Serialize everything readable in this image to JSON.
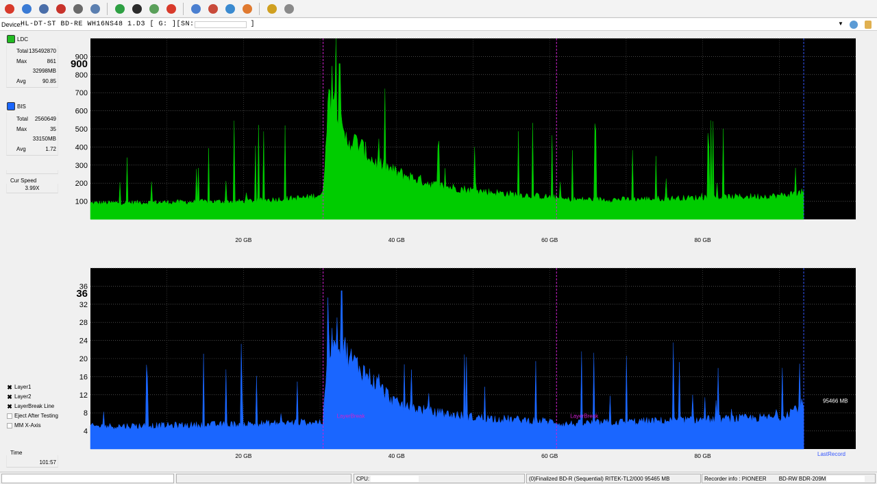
{
  "toolbar": {
    "buttons": [
      {
        "name": "power-button",
        "icon": "power-icon",
        "color": "#d83a2b"
      },
      {
        "name": "info-button",
        "icon": "info-icon",
        "color": "#3a7bd5"
      },
      {
        "name": "drive-info-button",
        "icon": "drive-icon",
        "color": "#4a6ea9"
      },
      {
        "name": "erase-button",
        "icon": "eraser-icon",
        "color": "#c8332b"
      },
      {
        "name": "eject-button",
        "icon": "eject-icon",
        "color": "#6a6a6a"
      },
      {
        "name": "media-button",
        "icon": "media-icon",
        "color": "#5b7fb0"
      },
      {
        "name": "refresh-button",
        "icon": "refresh-icon",
        "color": "#2ea043"
      },
      {
        "name": "scan-button",
        "icon": "scan-icon",
        "color": "#2b2b2b"
      },
      {
        "name": "settings-button",
        "icon": "settings-icon",
        "color": "#5aa05a"
      },
      {
        "name": "stop-button",
        "icon": "stop-icon",
        "color": "#d83a2b"
      },
      {
        "name": "disc-button",
        "icon": "disc-icon",
        "color": "#4a7fd0"
      },
      {
        "name": "burn-button",
        "icon": "burn-icon",
        "color": "#c84a3a"
      },
      {
        "name": "copy-button",
        "icon": "copy-icon",
        "color": "#3a8ad0"
      },
      {
        "name": "test-button",
        "icon": "test-icon",
        "color": "#e07a30"
      },
      {
        "name": "chart-button",
        "icon": "chart-icon",
        "color": "#d0a020"
      },
      {
        "name": "print-button",
        "icon": "printer-icon",
        "color": "#8a8a8a"
      }
    ]
  },
  "device": {
    "label": "Device:",
    "name": "HL-DT-ST BD-RE  WH16NS48  1.D3 [ G: ][SN:",
    "close": "]"
  },
  "sidebar": {
    "ldc": {
      "label": "LDC",
      "color": "#22bb22",
      "total_label": "Total",
      "total": "135492870",
      "max_label": "Max",
      "max": "861",
      "max_mb": "32998MB",
      "avg_label": "Avg",
      "avg": "90.85"
    },
    "bis": {
      "label": "BIS",
      "color": "#1a66ff",
      "total_label": "Total",
      "total": "2560649",
      "max_label": "Max",
      "max": "35",
      "max_mb": "33150MB",
      "avg_label": "Avg",
      "avg": "1.72"
    },
    "cur_speed_label": "Cur Speed",
    "cur_speed": "3.99X",
    "checkboxes": [
      {
        "label": "Layer1",
        "checked": true
      },
      {
        "label": "Layer2",
        "checked": true
      },
      {
        "label": "LayerBreak Line",
        "checked": true
      },
      {
        "label": "Eject After Testing",
        "checked": false
      },
      {
        "label": "MM X-Axis",
        "checked": false
      }
    ],
    "time_label": "Time",
    "time": "101:57"
  },
  "chart_data": [
    {
      "type": "area",
      "name": "LDC",
      "color": "#00cc00",
      "ylim": [
        0,
        1000
      ],
      "yticks": [
        100,
        200,
        300,
        400,
        500,
        600,
        700,
        800,
        900
      ],
      "ymax_label": "900",
      "xlim": [
        0,
        100
      ],
      "xticks": [
        20,
        40,
        60,
        80
      ],
      "xtick_labels": [
        "20 GB",
        "40 GB",
        "60 GB",
        "80 GB"
      ],
      "data_end_gb": 93.2,
      "layer_breaks_gb": [
        30.4,
        60.9
      ],
      "end_line_gb": 93.2,
      "baseline_profile": [
        [
          0,
          90
        ],
        [
          10,
          95
        ],
        [
          20,
          100
        ],
        [
          28,
          120
        ],
        [
          30.4,
          140
        ],
        [
          31,
          650
        ],
        [
          32,
          700
        ],
        [
          33,
          450
        ],
        [
          35,
          420
        ],
        [
          37,
          320
        ],
        [
          40,
          260
        ],
        [
          45,
          190
        ],
        [
          50,
          160
        ],
        [
          55,
          140
        ],
        [
          60.9,
          120
        ],
        [
          61.5,
          110
        ],
        [
          70,
          110
        ],
        [
          80,
          120
        ],
        [
          90,
          130
        ],
        [
          93.2,
          150
        ]
      ],
      "peak_value": 861,
      "peak_gb": 32.5
    },
    {
      "type": "area",
      "name": "BIS",
      "color": "#1a66ff",
      "ylim": [
        0,
        40
      ],
      "yticks": [
        4,
        8,
        12,
        16,
        20,
        24,
        28,
        32,
        36
      ],
      "ymax_label": "36",
      "xlim": [
        0,
        100
      ],
      "xticks": [
        20,
        40,
        60,
        80
      ],
      "xtick_labels": [
        "20 GB",
        "40 GB",
        "60 GB",
        "80 GB"
      ],
      "data_end_gb": 93.2,
      "layer_breaks_gb": [
        30.4,
        60.9
      ],
      "end_line_gb": 93.2,
      "baseline_profile": [
        [
          0,
          5
        ],
        [
          10,
          5.2
        ],
        [
          20,
          5.5
        ],
        [
          30.4,
          6
        ],
        [
          31,
          22
        ],
        [
          32,
          26
        ],
        [
          34,
          20
        ],
        [
          37,
          15
        ],
        [
          40,
          10
        ],
        [
          45,
          8
        ],
        [
          50,
          7
        ],
        [
          60.9,
          6
        ],
        [
          61.5,
          5.5
        ],
        [
          70,
          6
        ],
        [
          80,
          6.5
        ],
        [
          90,
          7
        ],
        [
          93.2,
          10
        ]
      ],
      "peak_value": 35,
      "peak_gb": 32.8,
      "layer_break_text": "LayerBreak",
      "size_annotation": "95466 MB",
      "last_record_label": "LastRecord"
    }
  ],
  "status": {
    "cpu_label": "CPU:",
    "disc_info": "(0)Finalized  BD-R (Sequential)  RITEK-TL2/000  95465 MB",
    "recorder_label": "Recorder info : PIONEER",
    "recorder_model": "BD-RW  BDR-209M"
  }
}
